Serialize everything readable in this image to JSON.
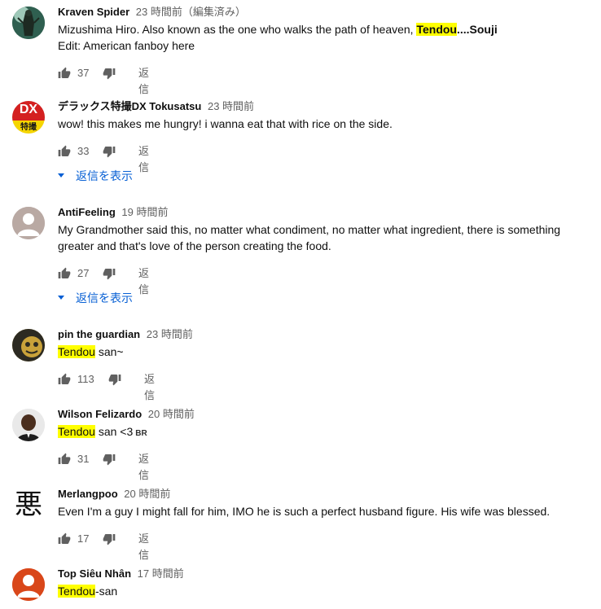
{
  "reply_label": "返信",
  "show_replies_label": "返信を表示",
  "comments": [
    {
      "author": "Kraven Spider",
      "time": "23 時間前",
      "edited": "（編集済み）",
      "line1_pre": "Mizushima Hiro. Also known as the one who walks the path of heaven, ",
      "line1_hl": "Tendou",
      "line1_post": "....Souji",
      "line2": "Edit: American fanboy here",
      "likes": "37"
    },
    {
      "author": "デラックス特撮DX Tokusatsu",
      "time": "23 時間前",
      "text": "wow! this makes me hungry! i wanna eat that with rice on the side.",
      "likes": "33",
      "avatar_text_top": "DX",
      "avatar_text_bottom": "特撮"
    },
    {
      "author": "AntiFeeling",
      "time": "19 時間前",
      "line1": "My Grandmother said this, no matter what condiment, no matter what ingredient, there is something",
      "line2": "greater and that's love of the person creating the food.",
      "likes": "27"
    },
    {
      "author": "pin the guardian",
      "time": "23 時間前",
      "hl": "Tendou",
      "post": " san~",
      "likes": "113"
    },
    {
      "author": "Wilson Felizardo",
      "time": "20 時間前",
      "hl": "Tendou",
      "post": " san <3",
      "flag": "BR",
      "likes": "31"
    },
    {
      "author": "Merlangpoo",
      "time": "20 時間前",
      "text": "Even I'm a guy I might fall for him, IMO he is such a perfect husband figure. His wife was blessed.",
      "likes": "17",
      "avatar_glyph": "悪"
    },
    {
      "author": "Top Siêu Nhân",
      "time": "17 時間前",
      "hl": "Tendou",
      "post": "-san"
    }
  ],
  "colors": {
    "highlight": "#ffff00",
    "link": "#065fd4",
    "muted": "#606060"
  }
}
